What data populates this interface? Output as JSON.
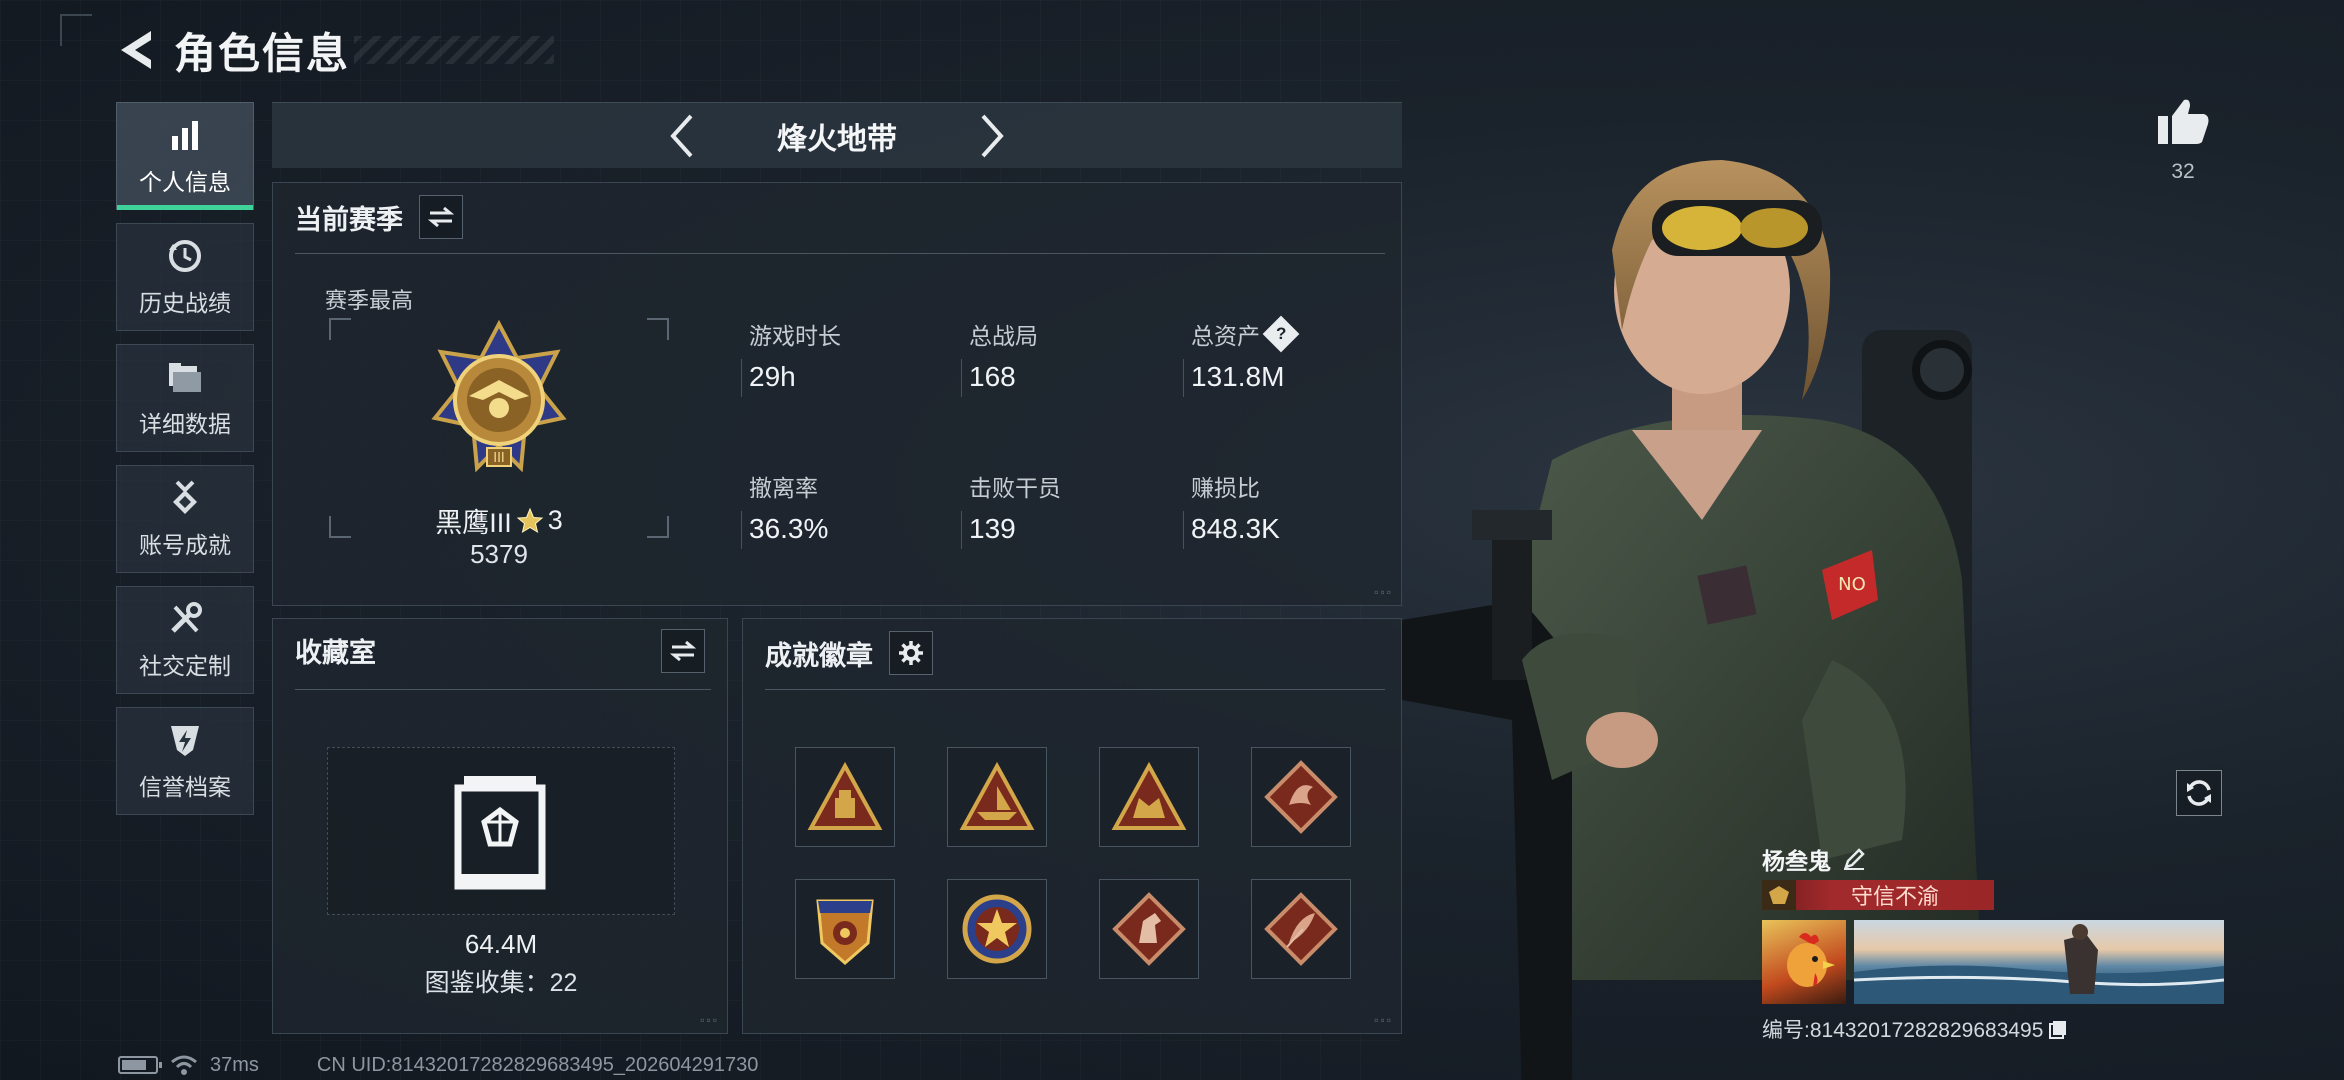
{
  "header": {
    "title": "角色信息"
  },
  "sidebar": {
    "items": [
      {
        "label": "个人信息",
        "icon": "bar-chart-icon",
        "active": true
      },
      {
        "label": "历史战绩",
        "icon": "history-clock-icon",
        "active": false
      },
      {
        "label": "详细数据",
        "icon": "folder-icon",
        "active": false
      },
      {
        "label": "账号成就",
        "icon": "medal-icon",
        "active": false
      },
      {
        "label": "社交定制",
        "icon": "tools-icon",
        "active": false
      },
      {
        "label": "信誉档案",
        "icon": "shield-bolt-icon",
        "active": false
      }
    ]
  },
  "map_selector": {
    "current": "烽火地带"
  },
  "season": {
    "title": "当前赛季",
    "best_label": "赛季最高",
    "rank_name": "黑鹰III",
    "rank_stars": "3",
    "rank_score": "5379",
    "stats": [
      {
        "label": "游戏时长",
        "value": "29h"
      },
      {
        "label": "总战局",
        "value": "168"
      },
      {
        "label": "总资产",
        "value": "131.8M",
        "help": "?"
      },
      {
        "label": "撤离率",
        "value": "36.3%"
      },
      {
        "label": "击败干员",
        "value": "139"
      },
      {
        "label": "赚损比",
        "value": "848.3K"
      }
    ]
  },
  "collection": {
    "title": "收藏室",
    "value": "64.4M",
    "count_text": "图鉴收集：22"
  },
  "achievements": {
    "title": "成就徽章",
    "badges": [
      "badge-1",
      "badge-2",
      "badge-3",
      "badge-4",
      "badge-5",
      "badge-6",
      "badge-7",
      "badge-8"
    ]
  },
  "likes": {
    "count": "32"
  },
  "player": {
    "name": "杨叁鬼",
    "title": "守信不渝",
    "id_text": "编号:8143201728282968349​5"
  },
  "status_bar": {
    "ping": "37ms",
    "uid": "CN UID:8143201728282968349​5_202604291730"
  },
  "colors": {
    "accent_green": "#3fd39a",
    "title_red": "#a22a2c",
    "gold": "#c9a24a"
  }
}
